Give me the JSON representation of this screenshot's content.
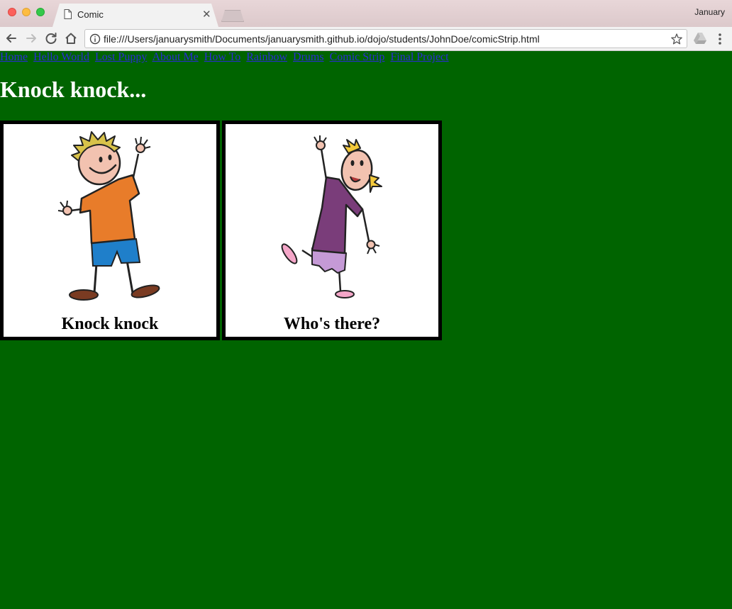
{
  "browser": {
    "tab_title": "Comic",
    "profile_name": "January",
    "url": "file:///Users/januarysmith/Documents/januarysmith.github.io/dojo/students/JohnDoe/comicStrip.html"
  },
  "nav": {
    "links": [
      "Home",
      "Hello World",
      "Lost Puppy",
      "About Me",
      "How To",
      "Rainbow",
      "Drums",
      "Comic Strip",
      "Final Project"
    ]
  },
  "page": {
    "heading": "Knock knock...",
    "panels": [
      {
        "caption": "Knock knock",
        "character": "boy waving"
      },
      {
        "caption": "Who's there?",
        "character": "girl waving"
      }
    ]
  },
  "colors": {
    "background": "#006400",
    "link": "#2b2bd6",
    "heading": "#ffffff"
  }
}
